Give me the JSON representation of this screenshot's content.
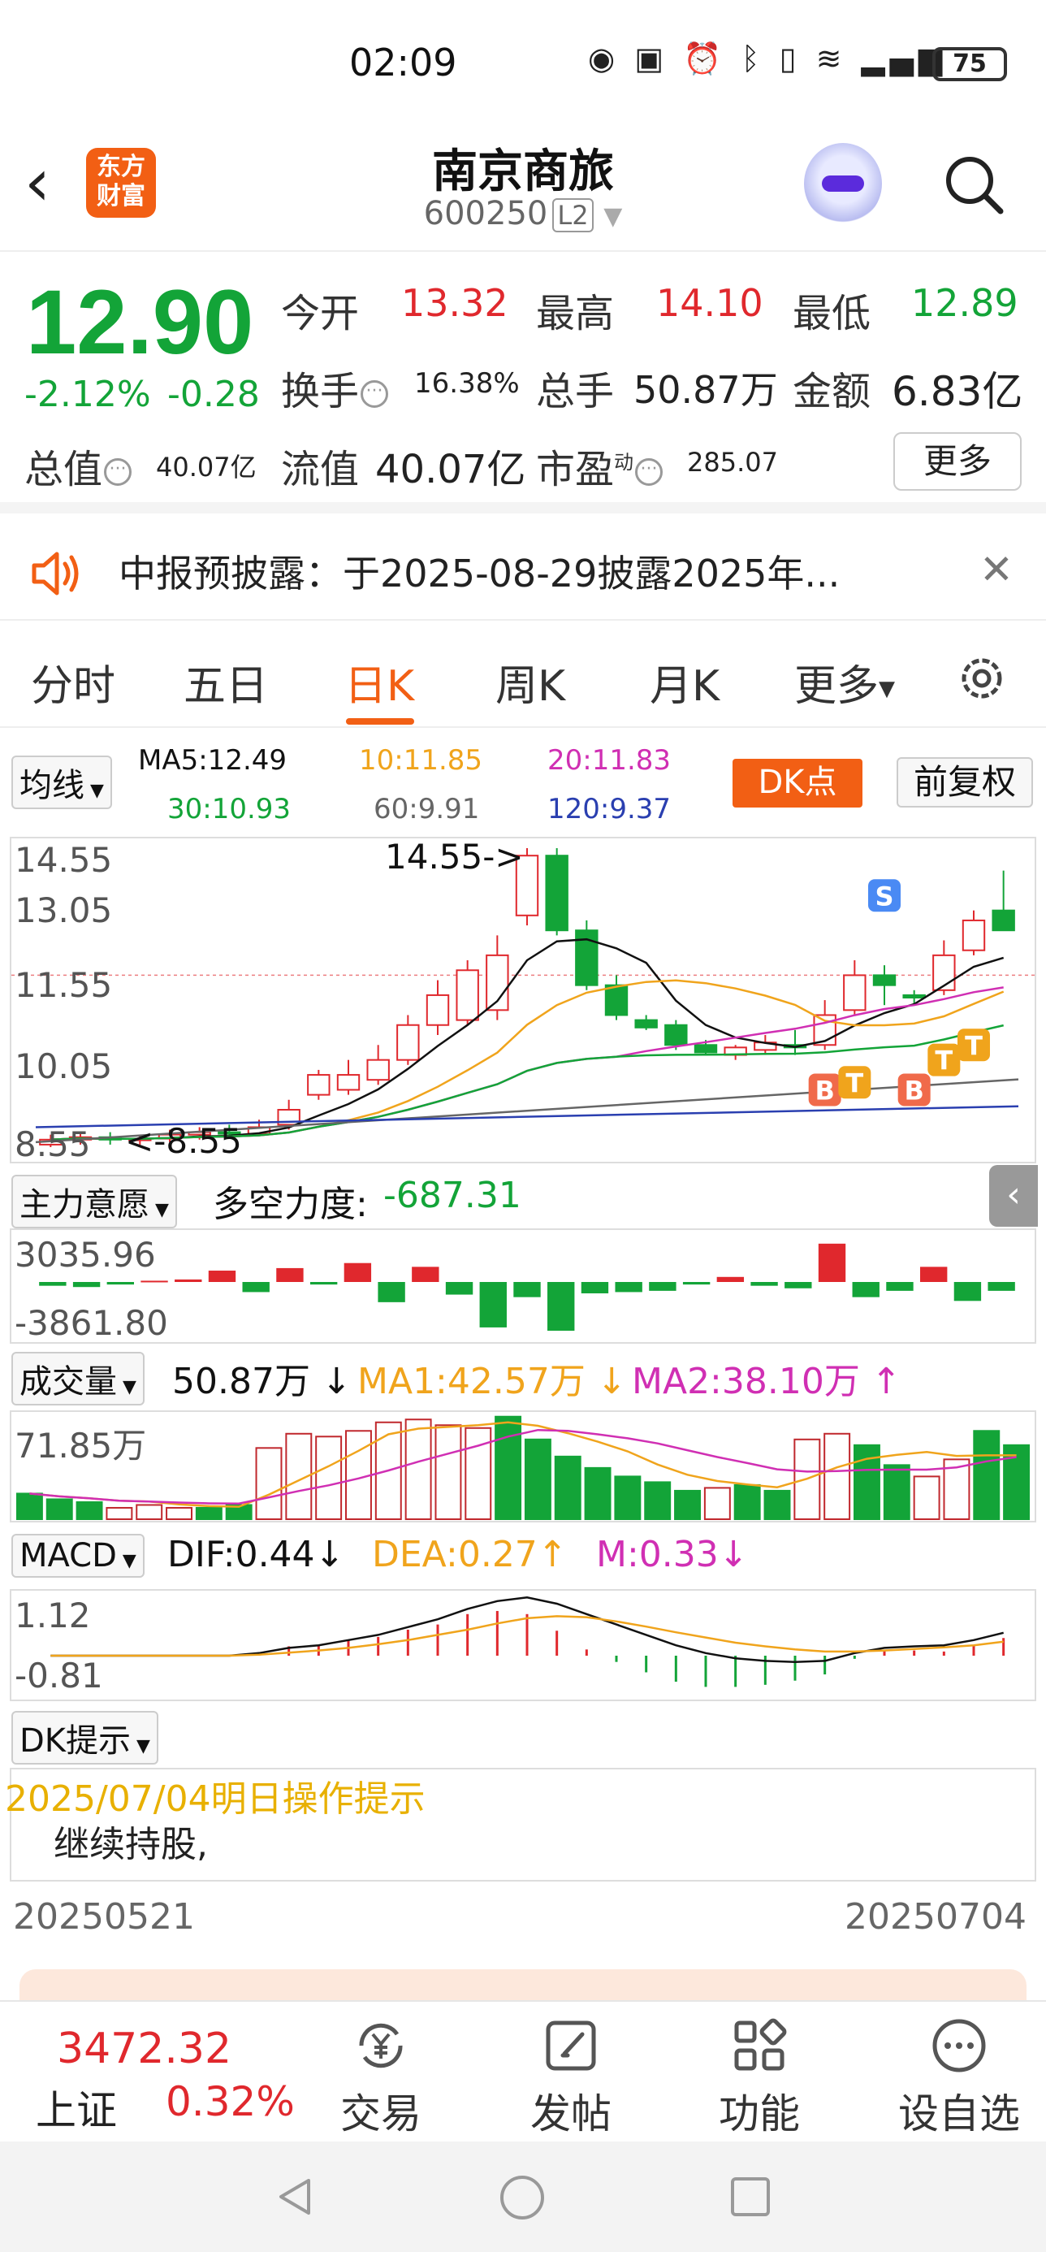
{
  "status_bar": {
    "time": "02:09",
    "battery": "75"
  },
  "header": {
    "logo_text": "东方财富",
    "stock_name": "南京商旅",
    "stock_code": "600250",
    "level_badge": "L2"
  },
  "quote": {
    "last_price": "12.90",
    "change_pct": "-2.12%",
    "change_amt": "-0.28",
    "open_label": "今开",
    "open_value": "13.32",
    "high_label": "最高",
    "high_value": "14.10",
    "low_label": "最低",
    "low_value": "12.89",
    "turnover_label": "换手",
    "turnover_value": "16.38%",
    "volume_label": "总手",
    "volume_value": "50.87万",
    "amount_label": "金额",
    "amount_value": "6.83亿",
    "mktcap_label": "总值",
    "mktcap_value": "40.07亿",
    "float_label": "流值",
    "float_value": "40.07亿",
    "pe_label": "市盈",
    "pe_sup": "动",
    "pe_value": "285.07",
    "more_label": "更多"
  },
  "notice": {
    "text": "中报预披露：于2025-08-29披露2025年..."
  },
  "period_tabs": [
    {
      "label": "分时"
    },
    {
      "label": "五日"
    },
    {
      "label": "日K"
    },
    {
      "label": "周K"
    },
    {
      "label": "月K"
    },
    {
      "label": "更多"
    }
  ],
  "ma_legend": {
    "selector": "均线",
    "ma5": "MA5:12.49",
    "ma10": "10:11.85",
    "ma20": "20:11.83",
    "ma30": "30:10.93",
    "ma60": "60:9.91",
    "ma120": "120:9.37",
    "dk_button": "DK点",
    "adjust_button": "前复权",
    "colors": {
      "ma5": "#111111",
      "ma10": "#f0a41c",
      "ma20": "#d02fb3",
      "ma30": "#13a438",
      "ma60": "#666666",
      "ma120": "#2a3fb0"
    }
  },
  "kline": {
    "y_labels": [
      "14.55",
      "13.05",
      "11.55",
      "10.05",
      "8.55"
    ],
    "max_annotation": "14.55->",
    "min_annotation": "<-8.55",
    "signals": [
      "S",
      "B",
      "T",
      "B",
      "T",
      "T"
    ],
    "chart_data": {
      "type": "candlestick",
      "ylim": [
        8.55,
        14.55
      ],
      "candles": [
        {
          "o": 8.6,
          "c": 8.7,
          "h": 8.8,
          "l": 8.55
        },
        {
          "o": 8.7,
          "c": 8.75,
          "h": 8.85,
          "l": 8.6
        },
        {
          "o": 8.75,
          "c": 8.7,
          "h": 8.85,
          "l": 8.6
        },
        {
          "o": 8.7,
          "c": 8.72,
          "h": 8.8,
          "l": 8.6
        },
        {
          "o": 8.72,
          "c": 8.8,
          "h": 8.9,
          "l": 8.65
        },
        {
          "o": 8.8,
          "c": 8.85,
          "h": 8.95,
          "l": 8.7
        },
        {
          "o": 8.85,
          "c": 8.82,
          "h": 9.0,
          "l": 8.75
        },
        {
          "o": 8.82,
          "c": 8.95,
          "h": 9.1,
          "l": 8.8
        },
        {
          "o": 9.0,
          "c": 9.3,
          "h": 9.5,
          "l": 8.9
        },
        {
          "o": 9.6,
          "c": 10.0,
          "h": 10.1,
          "l": 9.5
        },
        {
          "o": 9.7,
          "c": 10.0,
          "h": 10.3,
          "l": 9.6
        },
        {
          "o": 9.9,
          "c": 10.3,
          "h": 10.6,
          "l": 9.8
        },
        {
          "o": 10.3,
          "c": 11.0,
          "h": 11.2,
          "l": 10.2
        },
        {
          "o": 11.0,
          "c": 11.6,
          "h": 11.9,
          "l": 10.8
        },
        {
          "o": 11.1,
          "c": 12.1,
          "h": 12.3,
          "l": 11.0
        },
        {
          "o": 11.3,
          "c": 12.4,
          "h": 12.8,
          "l": 11.1
        },
        {
          "o": 13.2,
          "c": 14.4,
          "h": 14.55,
          "l": 13.0
        },
        {
          "o": 14.4,
          "c": 12.9,
          "h": 14.55,
          "l": 12.8
        },
        {
          "o": 12.9,
          "c": 11.8,
          "h": 13.1,
          "l": 11.7
        },
        {
          "o": 11.8,
          "c": 11.2,
          "h": 12.0,
          "l": 11.1
        },
        {
          "o": 11.1,
          "c": 10.95,
          "h": 11.2,
          "l": 10.9
        },
        {
          "o": 11.0,
          "c": 10.6,
          "h": 11.1,
          "l": 10.5
        },
        {
          "o": 10.6,
          "c": 10.45,
          "h": 10.7,
          "l": 10.4
        },
        {
          "o": 10.4,
          "c": 10.55,
          "h": 10.6,
          "l": 10.3
        },
        {
          "o": 10.5,
          "c": 10.65,
          "h": 10.8,
          "l": 10.4
        },
        {
          "o": 10.6,
          "c": 10.55,
          "h": 10.9,
          "l": 10.4
        },
        {
          "o": 10.6,
          "c": 11.2,
          "h": 11.5,
          "l": 10.5
        },
        {
          "o": 11.3,
          "c": 12.0,
          "h": 12.3,
          "l": 11.2
        },
        {
          "o": 12.0,
          "c": 11.8,
          "h": 12.2,
          "l": 11.4
        },
        {
          "o": 11.6,
          "c": 11.55,
          "h": 11.7,
          "l": 11.4
        },
        {
          "o": 11.7,
          "c": 12.4,
          "h": 12.7,
          "l": 11.6
        },
        {
          "o": 12.5,
          "c": 13.1,
          "h": 13.3,
          "l": 12.4
        },
        {
          "o": 13.3,
          "c": 12.9,
          "h": 14.1,
          "l": 12.89
        }
      ]
    }
  },
  "force_panel": {
    "selector": "主力意愿",
    "label": "多空力度:",
    "value": "-687.31",
    "y_top": "3035.96",
    "y_bottom": "-3861.80",
    "chart_data": {
      "type": "bar",
      "values": [
        -300,
        -400,
        -200,
        100,
        200,
        900,
        -800,
        1100,
        -200,
        1500,
        -1600,
        1200,
        -1000,
        -3600,
        -1200,
        -3861.8,
        -900,
        -800,
        -700,
        -200,
        400,
        -300,
        -500,
        3035.96,
        -1200,
        -700,
        1200,
        -1500,
        -700
      ]
    }
  },
  "volume_panel": {
    "selector": "成交量",
    "value": "50.87万",
    "ma1": "MA1:42.57万",
    "ma2": "MA2:38.10万",
    "y_top": "71.85万",
    "chart_data": {
      "type": "bar",
      "ymax": 71.85,
      "values": [
        18,
        14,
        12,
        8,
        10,
        8,
        8,
        10,
        50,
        60,
        58,
        62,
        68,
        70,
        66,
        64,
        72,
        56,
        44,
        36,
        30,
        26,
        20,
        22,
        24,
        20,
        56,
        60,
        52,
        38,
        30,
        42,
        62,
        52
      ],
      "up": [
        0,
        0,
        0,
        1,
        1,
        1,
        0,
        0,
        1,
        1,
        1,
        1,
        1,
        1,
        1,
        1,
        0,
        0,
        0,
        0,
        0,
        0,
        0,
        1,
        0,
        0,
        1,
        1,
        0,
        0,
        1,
        1,
        0
      ]
    }
  },
  "macd_panel": {
    "selector": "MACD",
    "dif": "DIF:0.44",
    "dea": "DEA:0.27",
    "m": "M:0.33",
    "y_top": "1.12",
    "y_bottom": "-0.81",
    "chart_data": {
      "type": "line",
      "dif": [
        0,
        0,
        0,
        0,
        0,
        0,
        0,
        0.05,
        0.15,
        0.2,
        0.3,
        0.4,
        0.55,
        0.7,
        0.9,
        1.05,
        1.12,
        1.0,
        0.8,
        0.6,
        0.4,
        0.2,
        0.05,
        -0.05,
        -0.1,
        -0.12,
        -0.1,
        0.05,
        0.15,
        0.18,
        0.2,
        0.3,
        0.44
      ],
      "dea": [
        0,
        0,
        0,
        0,
        0,
        0,
        0,
        0.02,
        0.06,
        0.1,
        0.15,
        0.22,
        0.3,
        0.4,
        0.5,
        0.62,
        0.72,
        0.76,
        0.74,
        0.66,
        0.56,
        0.45,
        0.35,
        0.25,
        0.18,
        0.12,
        0.08,
        0.08,
        0.1,
        0.13,
        0.16,
        0.2,
        0.27
      ]
    }
  },
  "dk_panel": {
    "selector": "DK提示",
    "tip_date": "2025/07/04明日操作提示",
    "tip_text": "继续持股,",
    "date_start": "20250521",
    "date_end": "20250704"
  },
  "bottom_nav": {
    "index_value": "3472.32",
    "index_name": "上证",
    "index_change": "0.32%",
    "items": [
      {
        "label": "交易",
        "icon": "yen-exchange-icon"
      },
      {
        "label": "发帖",
        "icon": "edit-icon"
      },
      {
        "label": "功能",
        "icon": "grid-icon"
      },
      {
        "label": "设自选",
        "icon": "more-dots-icon"
      }
    ]
  }
}
